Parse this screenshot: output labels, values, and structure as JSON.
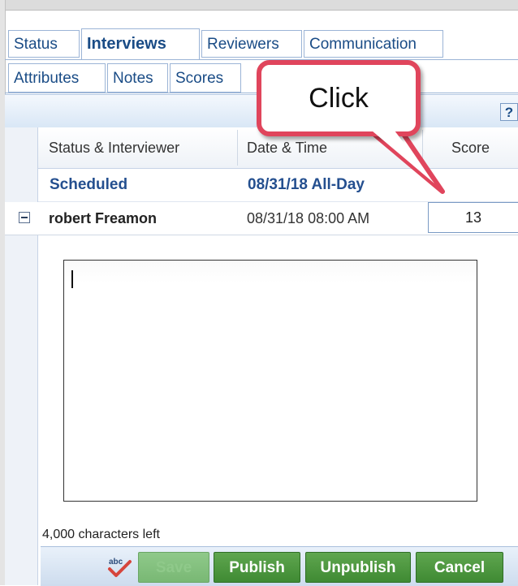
{
  "tabs_row1": [
    {
      "label": "Status",
      "active": false
    },
    {
      "label": "Interviews",
      "active": true
    },
    {
      "label": "Reviewers",
      "active": false
    },
    {
      "label": "Communication",
      "active": false
    }
  ],
  "tabs_row2": [
    {
      "label": "Attributes"
    },
    {
      "label": "Notes"
    },
    {
      "label": "Scores"
    }
  ],
  "toolbar": {
    "help_label": "?"
  },
  "grid": {
    "headers": {
      "status_interviewer": "Status & Interviewer",
      "date_time": "Date & Time",
      "score": "Score"
    },
    "group": {
      "status": "Scheduled",
      "date": "08/31/18 All-Day"
    },
    "row": {
      "interviewer": "robert Freamon",
      "datetime": "08/31/18 08:00 AM",
      "score": "13"
    }
  },
  "editor": {
    "value": "",
    "chars_left": "4,000 characters left"
  },
  "buttons": {
    "save": "Save",
    "publish": "Publish",
    "unpublish": "Unpublish",
    "cancel": "Cancel"
  },
  "callout": {
    "text": "Click"
  },
  "colors": {
    "tab_text": "#1a4c86",
    "group_text": "#244f8f",
    "button_green": "#3f8a33",
    "callout_border": "#e0455c"
  },
  "icons": {
    "expander": "collapse-minus-icon",
    "spellcheck": "spellcheck-icon",
    "help": "help-icon"
  }
}
